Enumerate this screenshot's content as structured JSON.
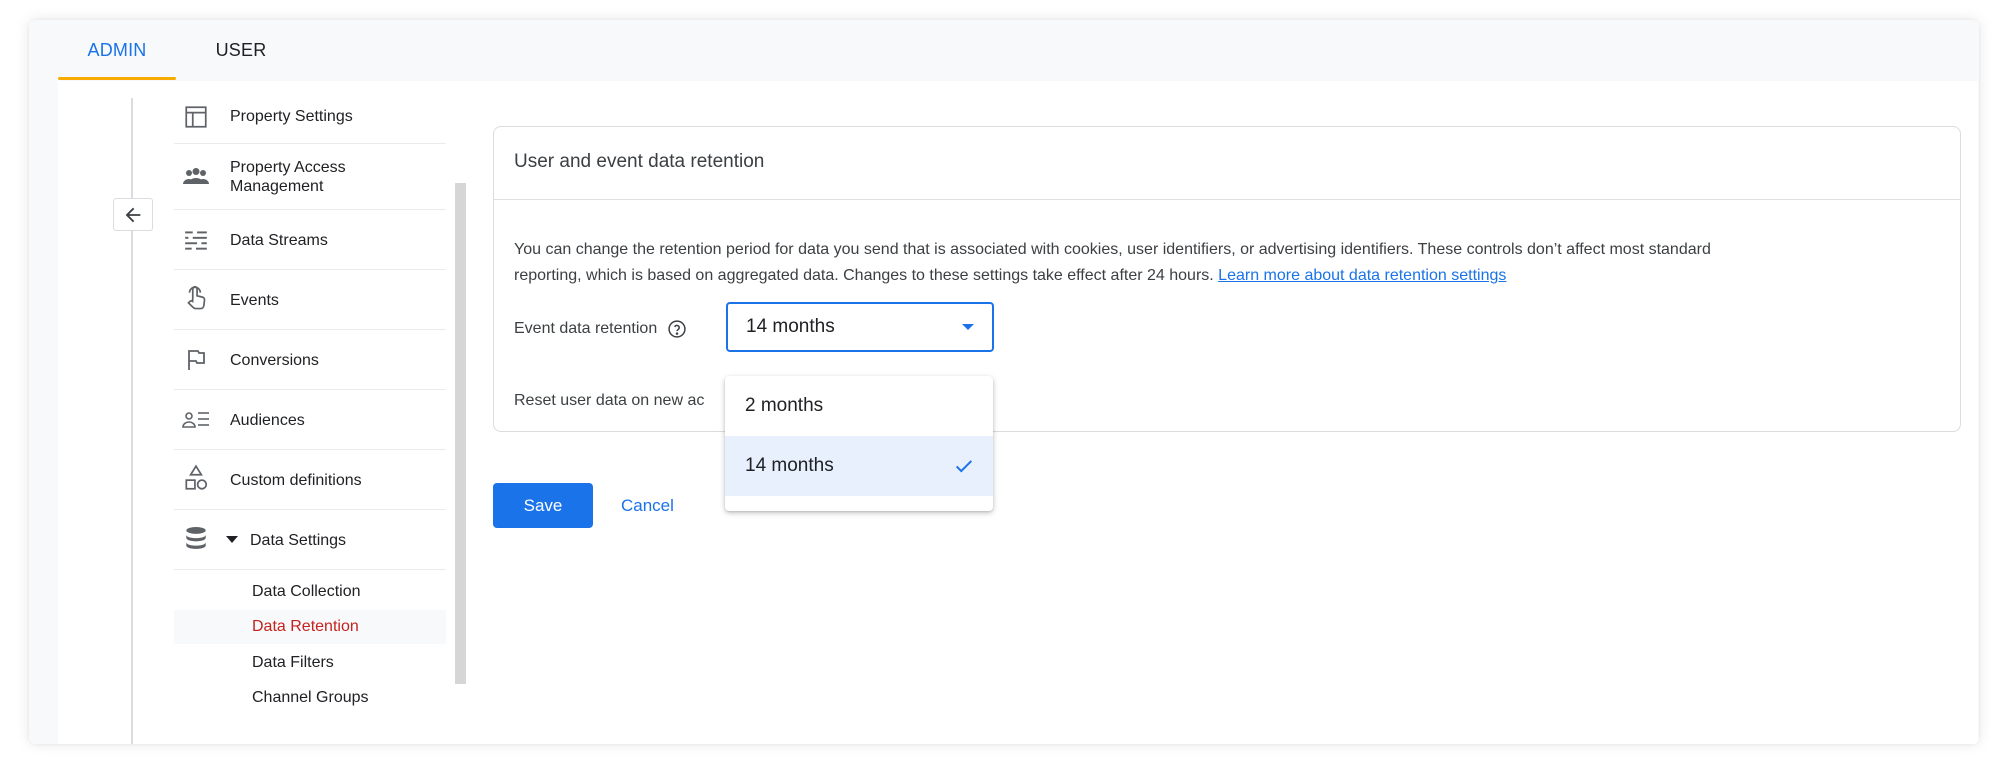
{
  "tabs": [
    {
      "label": "ADMIN",
      "active": true
    },
    {
      "label": "USER",
      "active": false
    }
  ],
  "nav": {
    "items": [
      {
        "label": "Property Settings",
        "icon": "property-settings-icon"
      },
      {
        "label": "Property Access Management",
        "icon": "people-icon"
      },
      {
        "label": "Data Streams",
        "icon": "data-streams-icon"
      },
      {
        "label": "Events",
        "icon": "touch-icon"
      },
      {
        "label": "Conversions",
        "icon": "flag-icon"
      },
      {
        "label": "Audiences",
        "icon": "audiences-icon"
      },
      {
        "label": "Custom definitions",
        "icon": "shapes-icon"
      },
      {
        "label": "Data Settings",
        "icon": "database-icon"
      }
    ],
    "sub_items": [
      {
        "label": "Data Collection",
        "active": false
      },
      {
        "label": "Data Retention",
        "active": true
      },
      {
        "label": "Data Filters",
        "active": false
      },
      {
        "label": "Channel Groups",
        "active": false
      }
    ]
  },
  "card": {
    "title": "User and event data retention",
    "description_line1": "You can change the retention period for data you send that is associated with cookies, user identifiers, or advertising identifiers. These controls don’t affect most standard",
    "description_line2": "reporting, which is based on aggregated data. Changes to these settings take effect after 24 hours.",
    "learn_more": "Learn more about data retention settings",
    "event_retention_label": "Event data retention",
    "selected_value": "14 months",
    "reset_label": "Reset user data on new ac"
  },
  "dropdown": {
    "options": [
      {
        "label": "2 months",
        "selected": false
      },
      {
        "label": "14 months",
        "selected": true
      }
    ]
  },
  "actions": {
    "save": "Save",
    "cancel": "Cancel"
  },
  "colors": {
    "accent": "#1a73e8",
    "tab_underline": "#f9ab00",
    "active_nav_text": "#c5221f",
    "selected_option_bg": "#e8f0fe"
  }
}
